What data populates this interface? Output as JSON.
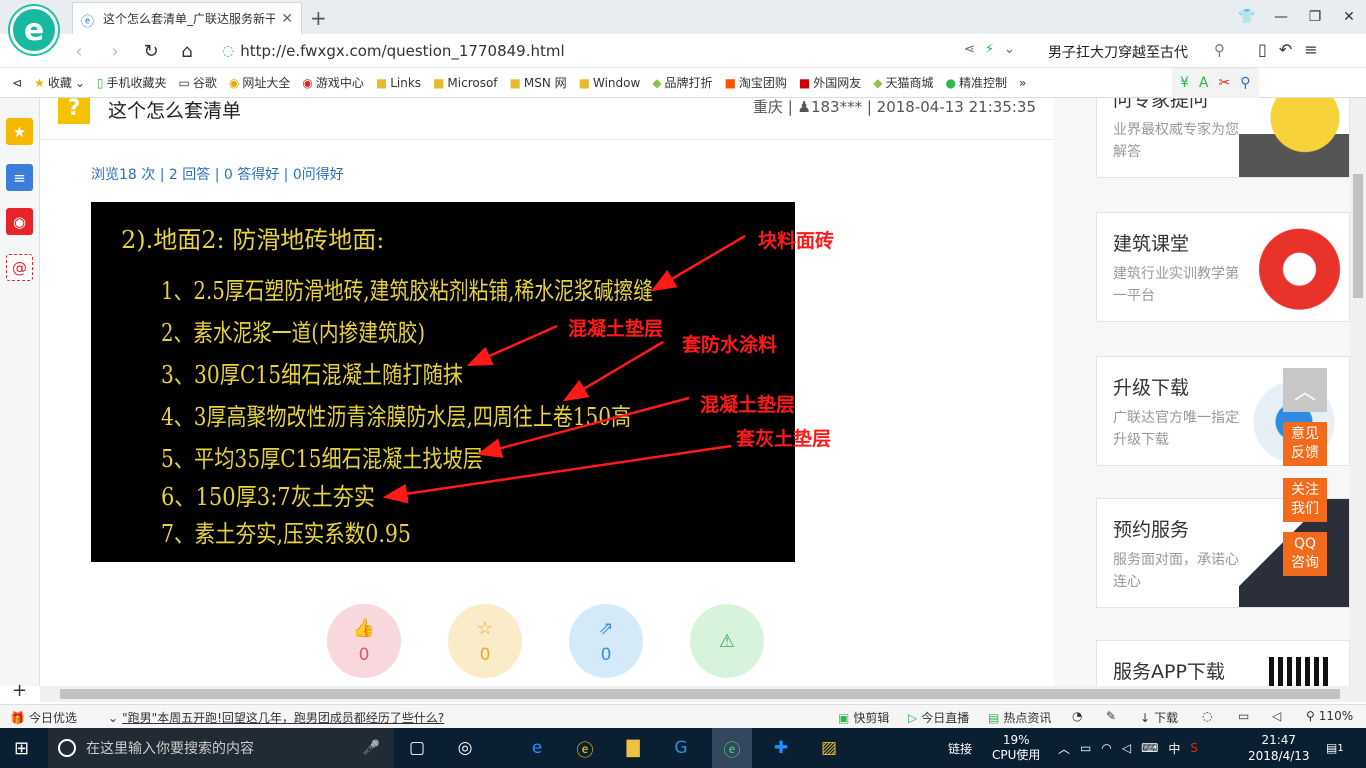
{
  "browser": {
    "tab_title": "这个怎么套清单_广联达服务新干线",
    "url": "http://e.fwxgx.com/question_1770849.html",
    "hot_search": "男子扛大刀穿越至古代",
    "bookmarks": [
      "收藏",
      "手机收藏夹",
      "谷歌",
      "网址大全",
      "游戏中心",
      "Links",
      "Microsof",
      "MSN 网",
      "Window",
      "品牌打折",
      "淘宝团购",
      "外国网友",
      "天猫商城",
      "精准控制"
    ]
  },
  "question": {
    "title": "这个怎么套清单",
    "meta": "重庆 | ♟183*** | 2018-04-13 21:35:35",
    "stats": "浏览18 次 | 2 回答 | 0 答得好 | 0问得好",
    "votes": [
      "0",
      "0",
      "0"
    ]
  },
  "drawing": {
    "heading": "2).地面2: 防滑地砖地面:",
    "lines": [
      "1、2.5厚石塑防滑地砖,建筑胶粘剂粘铺,稀水泥浆碱擦缝",
      "2、素水泥浆一道(内掺建筑胶)",
      "3、30厚C15细石混凝土随打随抹",
      "4、3厚高聚物改性沥青涂膜防水层,四周往上卷150高",
      "5、平均35厚C15细石混凝土找坡层",
      "6、150厚3:7灰土夯实",
      "7、素土夯实,压实系数0.95"
    ],
    "annotations": [
      "块料面砖",
      "混凝土垫层",
      "套防水涂料",
      "混凝土垫层",
      "套灰土垫层"
    ],
    "text_color": "#e6d33a",
    "annotation_color": "#ff1a1a"
  },
  "right_cards": [
    {
      "title": "问专家提问",
      "sub": "业界最权威专家为您解答"
    },
    {
      "title": "建筑课堂",
      "sub": "建筑行业实训教学第一平台"
    },
    {
      "title": "升级下载",
      "sub": "广联达官方唯一指定升级下载"
    },
    {
      "title": "预约服务",
      "sub": "服务面对面，承诺心连心"
    },
    {
      "title": "服务APP下载",
      "sub": ""
    }
  ],
  "float_buttons": [
    "意见反馈",
    "关注我们",
    "QQ咨询"
  ],
  "statusbar": {
    "today": "今日优选",
    "news": "\"跑男\"本周五开跑!回望这几年，跑男团成员都经历了些什么?",
    "items": [
      "快剪辑",
      "今日直播",
      "热点资讯",
      "下载"
    ],
    "zoom": "110%"
  },
  "taskbar": {
    "search_placeholder": "在这里输入你要搜索的内容",
    "network": "链接",
    "cpu_percent": "19%",
    "cpu_label": "CPU使用",
    "ime": "中",
    "time": "21:47",
    "date": "2018/4/13",
    "notify": "1"
  }
}
